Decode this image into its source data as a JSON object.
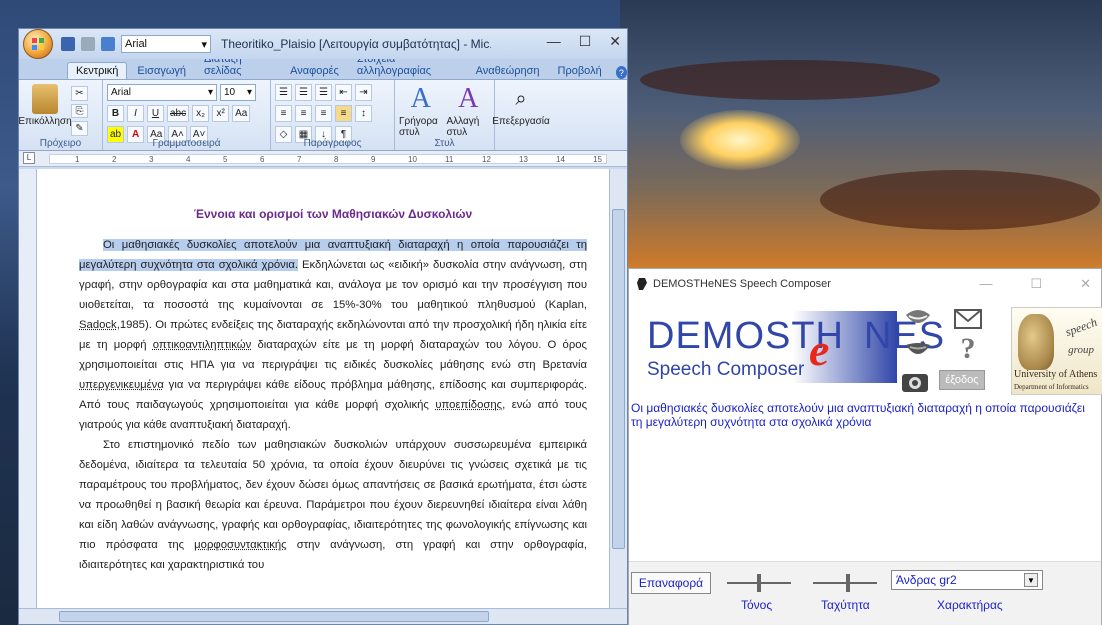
{
  "word": {
    "title": "Theoritiko_Plaisio [Λειτουργία συμβατότητας] - Mic...",
    "qat_font": "Arial",
    "tabs": [
      "Κεντρική",
      "Εισαγωγή",
      "Διάταξη σελίδας",
      "Αναφορές",
      "Στοιχεία αλληλογραφίας",
      "Αναθεώρηση",
      "Προβολή"
    ],
    "ribbon": {
      "paste_label": "Επικόλληση",
      "font_name": "Arial",
      "font_size": "10",
      "quick_styles_label": "Γρήγορα στυλ",
      "change_styles_label": "Αλλαγή στυλ",
      "editing_label": "Επεξεργασία",
      "groups": {
        "clipboard": "Πρόχειρο",
        "font": "Γραμματοσειρά",
        "paragraph": "Παράγραφος",
        "styles": "Στυλ"
      }
    },
    "ruler_ticks": [
      "1",
      "2",
      "3",
      "4",
      "5",
      "6",
      "7",
      "8",
      "9",
      "10",
      "11",
      "12",
      "13",
      "14",
      "15"
    ],
    "document": {
      "heading": "Έννοια και ορισμοί  των Μαθησιακών  Δυσκολιών",
      "p1_highlight": "Οι μαθησιακές δυσκολίες αποτελούν μια αναπτυξιακή διαταραχή η οποία παρουσιάζει τη μεγαλύτερη συχνότητα στα σχολικά χρόνια.",
      "p1_part_a": " Εκδηλώνεται ως «ειδική» δυσκολία στην ανάγνωση, στη γραφή, στην ορθογραφία και στα μαθηματικά και, ανάλογα με τον ορισμό και την προσέγγιση που υιοθετείται, τα ποσοστά της κυμαίνονται σε 15%-30% του μαθητικού πληθυσμού (Kaplan, ",
      "p1_sadock": "Sadock",
      "p1_part_b": ",1985). Οι πρώτες ενδείξεις της διαταραχής εκδηλώνονται από την προσχολική ήδη ηλικία  είτε με τη μορφή ",
      "p1_opt": "οπτικοαντιληπτικών",
      "p1_part_c": " διαταραχών είτε με τη μορφή διαταραχών του λόγου. Ο όρος χρησιμοποιείται στις ΗΠΑ για να περιγράψει τις ειδικές δυσκολίες μάθησης ενώ στη Βρετανία ",
      "p1_yper": "υπεργενικευμένα",
      "p1_part_d": " για να περιγράψει κάθε είδους πρόβλημα μάθησης, επίδοσης και συμπεριφοράς. Από τους παιδαγωγούς χρησιμοποιείται για κάθε μορφή σχολικής ",
      "p1_ypo": "υποεπίδοσης",
      "p1_part_e": ", ενώ από τους γιατρούς για κάθε αναπτυξιακή διαταραχή.",
      "p2_part_a": "Στο επιστημονικό πεδίο των μαθησιακών δυσκολιών υπάρχουν συσσωρευμένα εμπειρικά δεδομένα, ιδιαίτερα τα τελευταία 50 χρόνια, τα οποία έχουν διευρύνει τις γνώσεις σχετικά με τις παραμέτρους του προβλήματος, δεν έχουν δώσει όμως απαντήσεις σε βασικά ερωτήματα, έτσι ώστε να προωθηθεί η βασική θεωρία και έρευνα. Παράμετροι που έχουν διερευνηθεί ιδιαίτερα είναι λάθη και είδη λαθών ανάγνωσης, γραφής και ορθογραφίας, ιδιαιτερότητες της φωνολογικής επίγνωσης και πιο πρόσφατα της ",
      "p2_morf": "μορφοσυντακτικής",
      "p2_part_b": " στην ανάγνωση, στη γραφή και στην ορθογραφία, ιδιαιτερότητες και χαρακτηριστικά του"
    }
  },
  "demo": {
    "title": "DEMOSTHeNES Speech Composer",
    "logo_line1": "DEMOSTH",
    "logo_e": "e",
    "logo_line1b": "NES",
    "logo_line2": "Speech Composer",
    "exit_label": "έξοδος",
    "uoa_line1": "University of Athens",
    "uoa_line2": "Department of Informatics",
    "uoa_speech": "speech",
    "uoa_group": "group",
    "text": "Οι μαθησιακές δυσκολίες αποτελούν μια αναπτυξιακή διαταραχή η οποία παρουσιάζει τη μεγαλύτερη συχνότητα στα σχολικά χρόνια",
    "reset_label": "Επαναφορά",
    "tone_label": "Τόνος",
    "speed_label": "Ταχύτητα",
    "character_label": "Χαρακτήρας",
    "voice_value": "Άνδρας gr2",
    "tone_level": 0.5,
    "speed_level": 0.55
  }
}
